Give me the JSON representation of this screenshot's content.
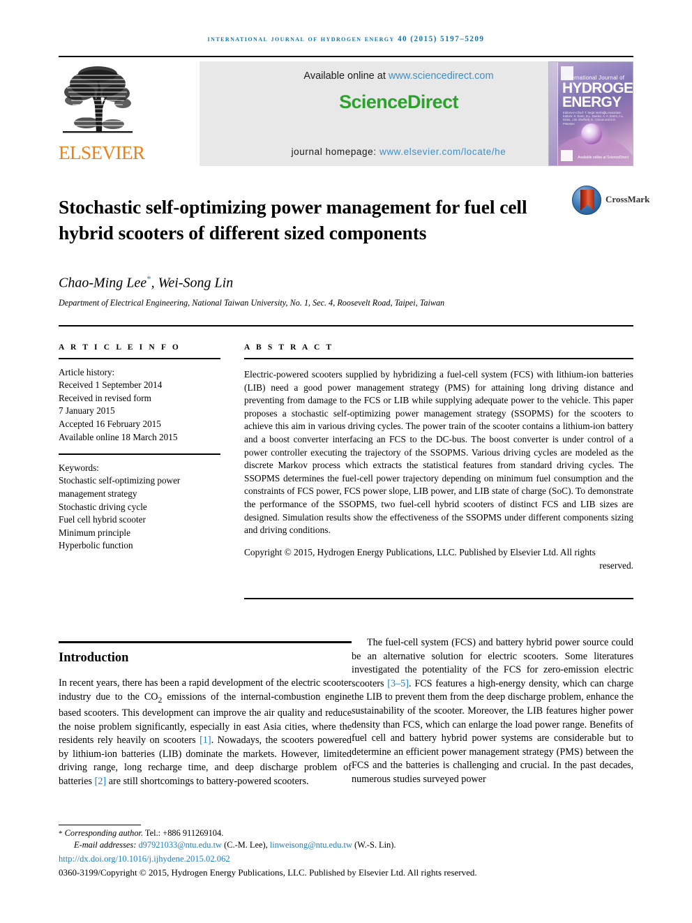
{
  "running_head": "International Journal of Hydrogen Energy 40 (2015) 5197–5209",
  "masthead": {
    "publisher": "ELSEVIER",
    "tree_logo": "elsevier-tree-logo",
    "available_prefix": "Available online at ",
    "available_url": "www.sciencedirect.com",
    "sciencedirect_logo": "ScienceDirect",
    "homepage_prefix": "journal homepage: ",
    "homepage_url": "www.elsevier.com/locate/he",
    "cover": {
      "line1": "International Journal of",
      "line2": "HYDROGEN",
      "line3": "ENERGY",
      "editors": "Editors-in-Chief: T. Nejat Veziroğlu\nAssociate Editors: S. Dunn, D.L. Damke, A. A. Evers, A.L. Dicks, J.W. Sheffield, E. Tzimas and E.E. Petersen",
      "sciencedirect": "Available online at\nScienceDirect"
    }
  },
  "article": {
    "title": "Stochastic self-optimizing power management for fuel cell hybrid scooters of different sized components",
    "crossmark_label": "CrossMark",
    "authors": "Chao-Ming Lee",
    "authors_star": "*",
    "authors_rest": ", Wei-Song Lin",
    "affiliation": "Department of Electrical Engineering, National Taiwan University, No. 1, Sec. 4, Roosevelt Road, Taipei, Taiwan"
  },
  "article_info": {
    "heading": "A R T I C L E   I N F O",
    "history_label": "Article history:",
    "history": [
      "Received 1 September 2014",
      "Received in revised form",
      "7 January 2015",
      "Accepted 16 February 2015",
      "Available online 18 March 2015"
    ],
    "keywords_label": "Keywords:",
    "keywords": [
      "Stochastic self-optimizing power",
      "management strategy",
      "Stochastic driving cycle",
      "Fuel cell hybrid scooter",
      "Minimum principle",
      "Hyperbolic function"
    ]
  },
  "abstract": {
    "heading": "A B S T R A C T",
    "body": "Electric-powered scooters supplied by hybridizing a fuel-cell system (FCS) with lithium-ion batteries (LIB) need a good power management strategy (PMS) for attaining long driving distance and preventing from damage to the FCS or LIB while supplying adequate power to the vehicle. This paper proposes a stochastic self-optimizing power management strategy (SSOPMS) for the scooters to achieve this aim in various driving cycles. The power train of the scooter contains a lithium-ion battery and a boost converter interfacing an FCS to the DC-bus. The boost converter is under control of a power controller executing the trajectory of the SSOPMS. Various driving cycles are modeled as the discrete Markov process which extracts the statistical features from standard driving cycles. The SSOPMS determines the fuel-cell power trajectory depending on minimum fuel consumption and the constraints of FCS power, FCS power slope, LIB power, and LIB state of charge (SoC). To demonstrate the performance of the SSOPMS, two fuel-cell hybrid scooters of distinct FCS and LIB sizes are designed. Simulation results show the effectiveness of the SSOPMS under different components sizing and driving conditions.",
    "copyright_main": "Copyright © 2015, Hydrogen Energy Publications, LLC. Published by Elsevier Ltd. All rights",
    "copyright_tail": "reserved."
  },
  "introduction": {
    "heading": "Introduction",
    "left_p1_a": "In recent years, there has been a rapid development of the electric scooter industry due to the CO",
    "left_p1_sub": "2",
    "left_p1_b": " emissions of the internal-combustion engine based scooters. This development can improve the air quality and reduce the noise problem significantly, especially in east Asia cities, where the residents rely heavily on scooters ",
    "left_ref1": "[1]",
    "left_p1_c": ". Nowadays, the scooters powered by lithium-ion batteries (LIB) dominate the markets. However, limited driving range, long recharge time, and deep discharge problem of batteries ",
    "left_ref2": "[2]",
    "left_p1_d": " are still shortcomings to battery-powered scooters.",
    "right_p1_a": "The fuel-cell system (FCS) and battery hybrid power source could be an alternative solution for electric scooters. Some literatures investigated the potentiality of the FCS for zero-emission electric scooters ",
    "right_ref1": "[3–5]",
    "right_p1_b": ". FCS features a high-energy density, which can charge the LIB to prevent them from the deep discharge problem, enhance the sustainability of the scooter. Moreover, the LIB features higher power density than FCS, which can enlarge the load power range. Benefits of fuel cell and battery hybrid power systems are considerable but to determine an efficient power management strategy (PMS) between the FCS and the batteries is challenging and crucial. In the past decades, numerous studies surveyed power"
  },
  "footer": {
    "corresponding_star": "*",
    "corresponding_label": "Corresponding author.",
    "corresponding_tel": " Tel.: +886 911269104.",
    "email_label": "E-mail addresses:",
    "email1": "d97921033@ntu.edu.tw",
    "email1_name": "(C.-M. Lee),",
    "email2": "linweisong@ntu.edu.tw",
    "email2_name": "(W.-S. Lin).",
    "doi": "http://dx.doi.org/10.1016/j.ijhydene.2015.02.062",
    "issn": "0360-3199/Copyright © 2015, Hydrogen Energy Publications, LLC. Published by Elsevier Ltd. All rights reserved."
  },
  "colors": {
    "running_head": "#1573a8",
    "link": "#1f7fbf",
    "sciencedirect_green": "#2ca22c",
    "elsevier_orange": "#f07f13",
    "url_blue": "#3f8fc4"
  }
}
